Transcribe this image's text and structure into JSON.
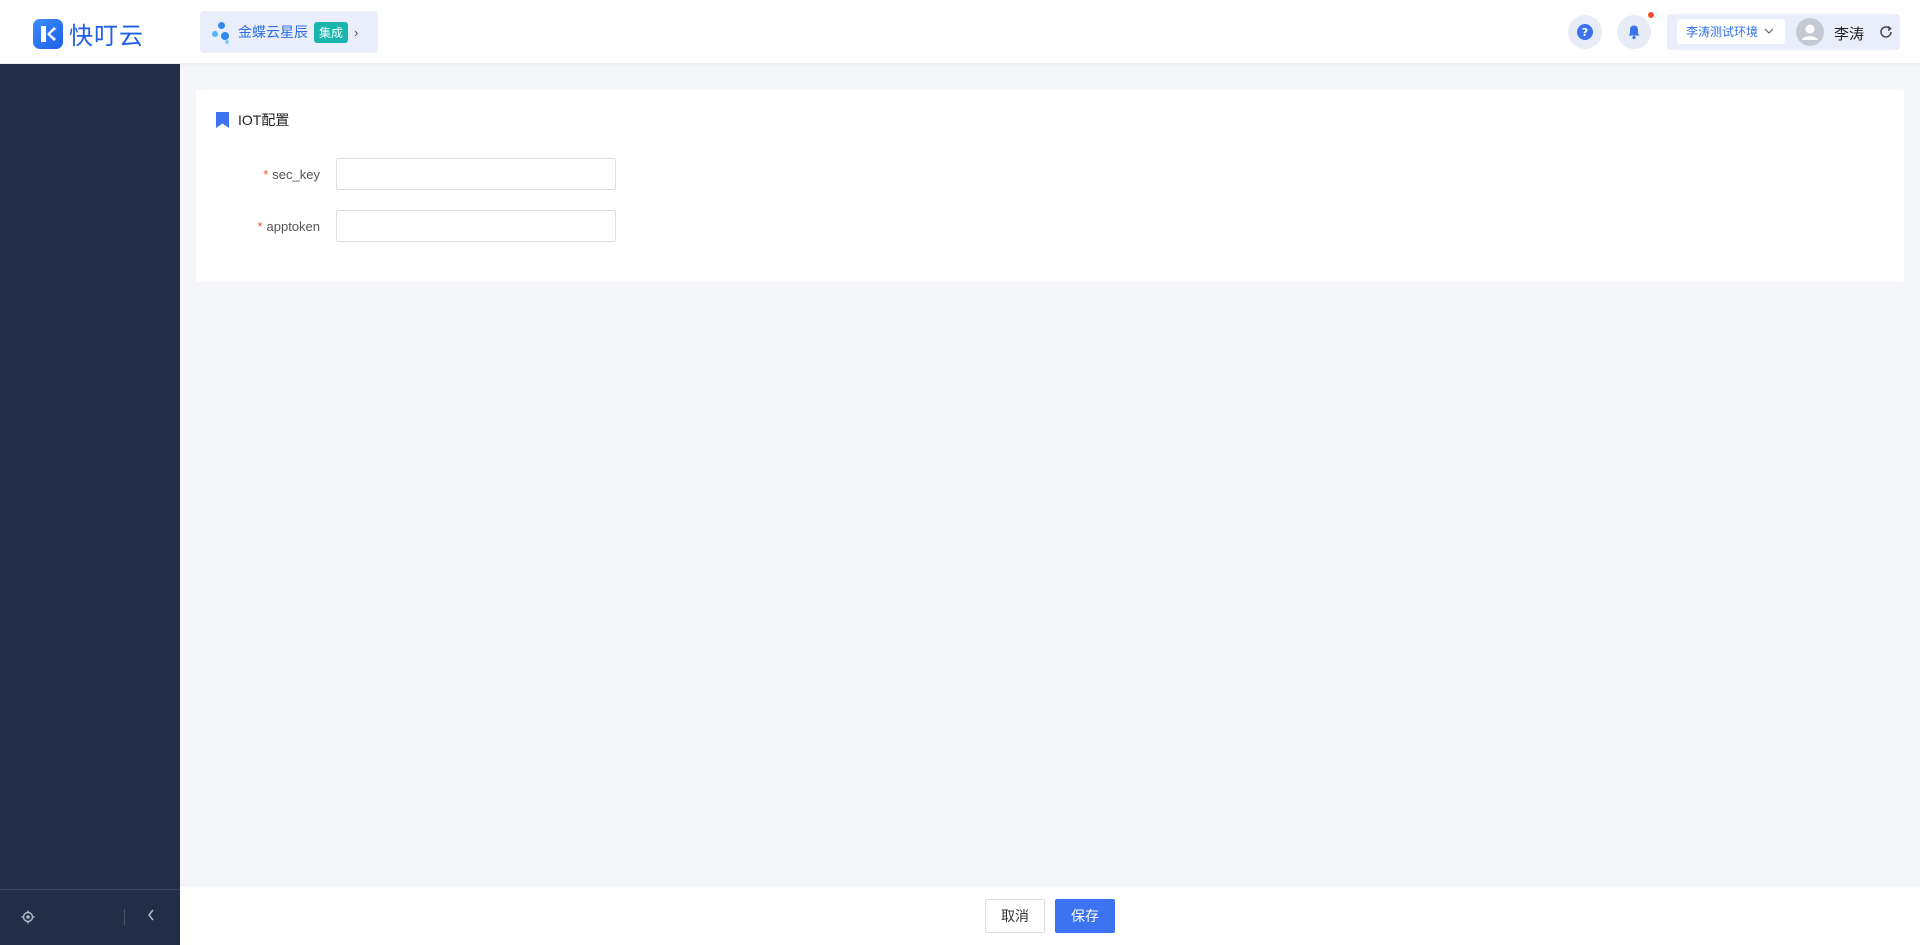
{
  "header": {
    "logo_text": "快叮云",
    "app_switch": {
      "name": "金蝶云星辰",
      "tag": "集成"
    },
    "environment": "李涛测试环境",
    "user_name": "李涛"
  },
  "card": {
    "title": "IOT配置",
    "fields": [
      {
        "label": "sec_key",
        "required_mark": "*",
        "value": "",
        "placeholder": ""
      },
      {
        "label": "apptoken",
        "required_mark": "*",
        "value": "",
        "placeholder": ""
      }
    ]
  },
  "footer": {
    "cancel_label": "取消",
    "save_label": "保存"
  },
  "colors": {
    "primary": "#3b73f0",
    "sidebar_bg": "#232d47",
    "required": "#f5512d",
    "tag_bg": "#19b6b0"
  }
}
